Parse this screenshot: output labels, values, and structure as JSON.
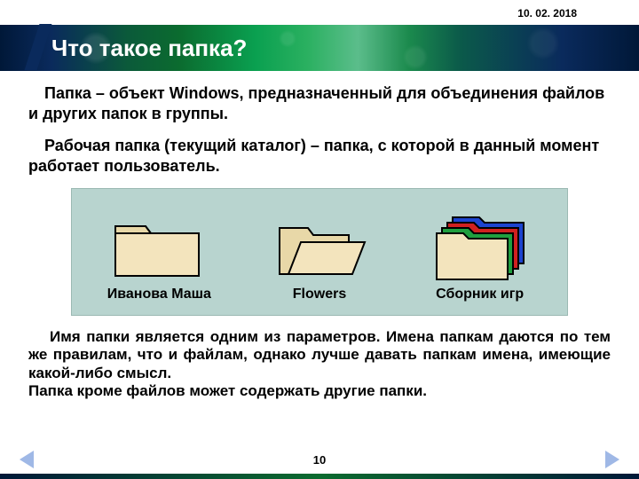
{
  "date": "10. 02. 2018",
  "title": "Что такое папка?",
  "paragraph1": {
    "term": "Папка",
    "rest": " – объект Windows, предназначенный для объединения файлов и других папок в группы."
  },
  "paragraph2": {
    "term": "Рабочая папка (текущий каталог)",
    "rest": " – папка, с которой в данный момент работает пользователь."
  },
  "folders": [
    {
      "label": "Иванова Маша"
    },
    {
      "label": "Flowers"
    },
    {
      "label": "Сборник игр"
    }
  ],
  "paragraph3": "Имя папки является одним из параметров. Имена папкам даются по тем же правилам, что и файлам, однако лучше давать папкам имена, имеющие какой-либо смысл.",
  "paragraph4": "Папка кроме файлов может содержать другие папки.",
  "page_number": "10"
}
